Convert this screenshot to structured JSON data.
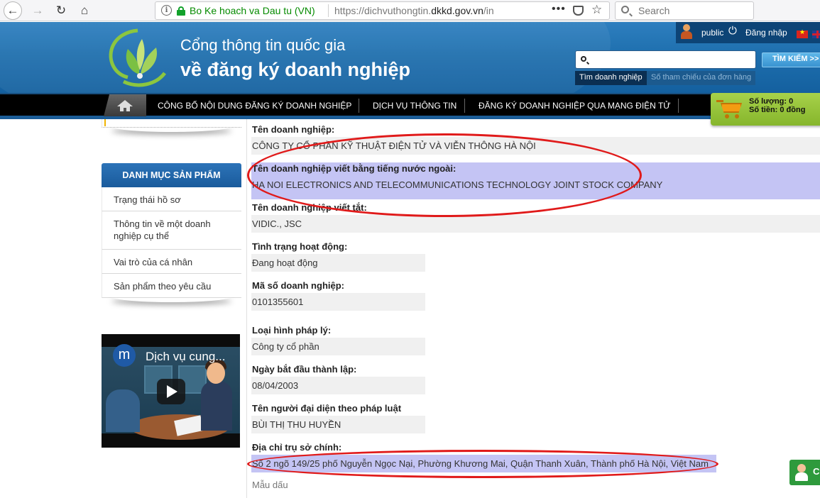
{
  "browser": {
    "identity": "Bo Ke hoach va Dau tu (VN)",
    "url_prefix": "https://dichvuthongtin.",
    "url_domain": "dkkd.gov.vn",
    "url_suffix": "/in",
    "info_glyph": "i",
    "menu_dots": "•••",
    "search_placeholder": "Search",
    "icons": [
      "back-arrow-icon",
      "forward-arrow-icon",
      "reload-icon",
      "home-icon",
      "info-icon",
      "lock-icon",
      "pocket-icon",
      "bookmark-star-icon",
      "search-icon"
    ]
  },
  "header": {
    "title_line1": "Cổng thông tin quốc gia",
    "title_line2": "về đăng ký doanh nghiệp",
    "user_name": "public",
    "login_label": "Đăng nhập",
    "search_button": "TÌM KIẾM >>",
    "search_value": "",
    "search_tabs": [
      "Tìm doanh nghiệp",
      "Số tham chiếu của đơn hàng"
    ],
    "brand_colors": {
      "header_blue": "#1e6fae",
      "nav_black": "#000000",
      "cart_green": "#8cbd31"
    }
  },
  "nav": {
    "items": [
      "CÔNG BỐ NỘI DUNG ĐĂNG KÝ DOANH NGHIỆP",
      "DỊCH VỤ THÔNG TIN",
      "ĐĂNG KÝ DOANH NGHIỆP QUA MẠNG ĐIỆN TỬ"
    ]
  },
  "cart": {
    "quantity": "Số lượng: 0",
    "amount": "Số tiền: 0 đồng"
  },
  "sidebar": {
    "menu_title": "DANH MỤC SẢN PHẨM",
    "items": [
      "Trạng thái hồ sơ",
      "Thông tin về một doanh nghiệp cụ thể",
      "Vai trò của cá nhân",
      "Sản phẩm theo yêu cầu"
    ],
    "video": {
      "channel_initial": "m",
      "title": "Dịch vụ cung..."
    }
  },
  "company": {
    "fields": [
      {
        "label": "Tên doanh nghiệp:",
        "value": "CÔNG TY CỔ PHẦN KỸ THUẬT ĐIỆN TỬ VÀ VIỄN THÔNG HÀ NỘI"
      },
      {
        "label": "Tên doanh nghiệp viết bằng tiếng nước ngoài:",
        "value": "HA NOI ELECTRONICS AND TELECOMMUNICATIONS TECHNOLOGY JOINT STOCK COMPANY"
      },
      {
        "label": "Tên doanh nghiệp viết tắt:",
        "value": "VIDIC., JSC"
      },
      {
        "label": "Tình trạng hoạt động:",
        "value": "Đang hoạt động"
      },
      {
        "label": "Mã số doanh nghiệp:",
        "value": "0101355601"
      },
      {
        "label": "Loại hình pháp lý:",
        "value": "Công ty cổ phần"
      },
      {
        "label": "Ngày bắt đầu thành lập:",
        "value": "08/04/2003"
      },
      {
        "label": "Tên người đại diện theo pháp luật",
        "value": "BÙI THỊ THU HUYỀN"
      },
      {
        "label": "Địa chỉ trụ sở chính:",
        "value": "Số 2 ngõ 149/25 phố Nguyễn Ngọc Nại, Phường Khương Mai, Quận Thanh Xuân, Thành phố Hà Nội, Việt Nam"
      }
    ],
    "seal_label": "Mẫu dấu",
    "annotation_color": "#e01a1a",
    "highlight_color": "#c4c4f4"
  },
  "chat": {
    "letter": "C"
  }
}
